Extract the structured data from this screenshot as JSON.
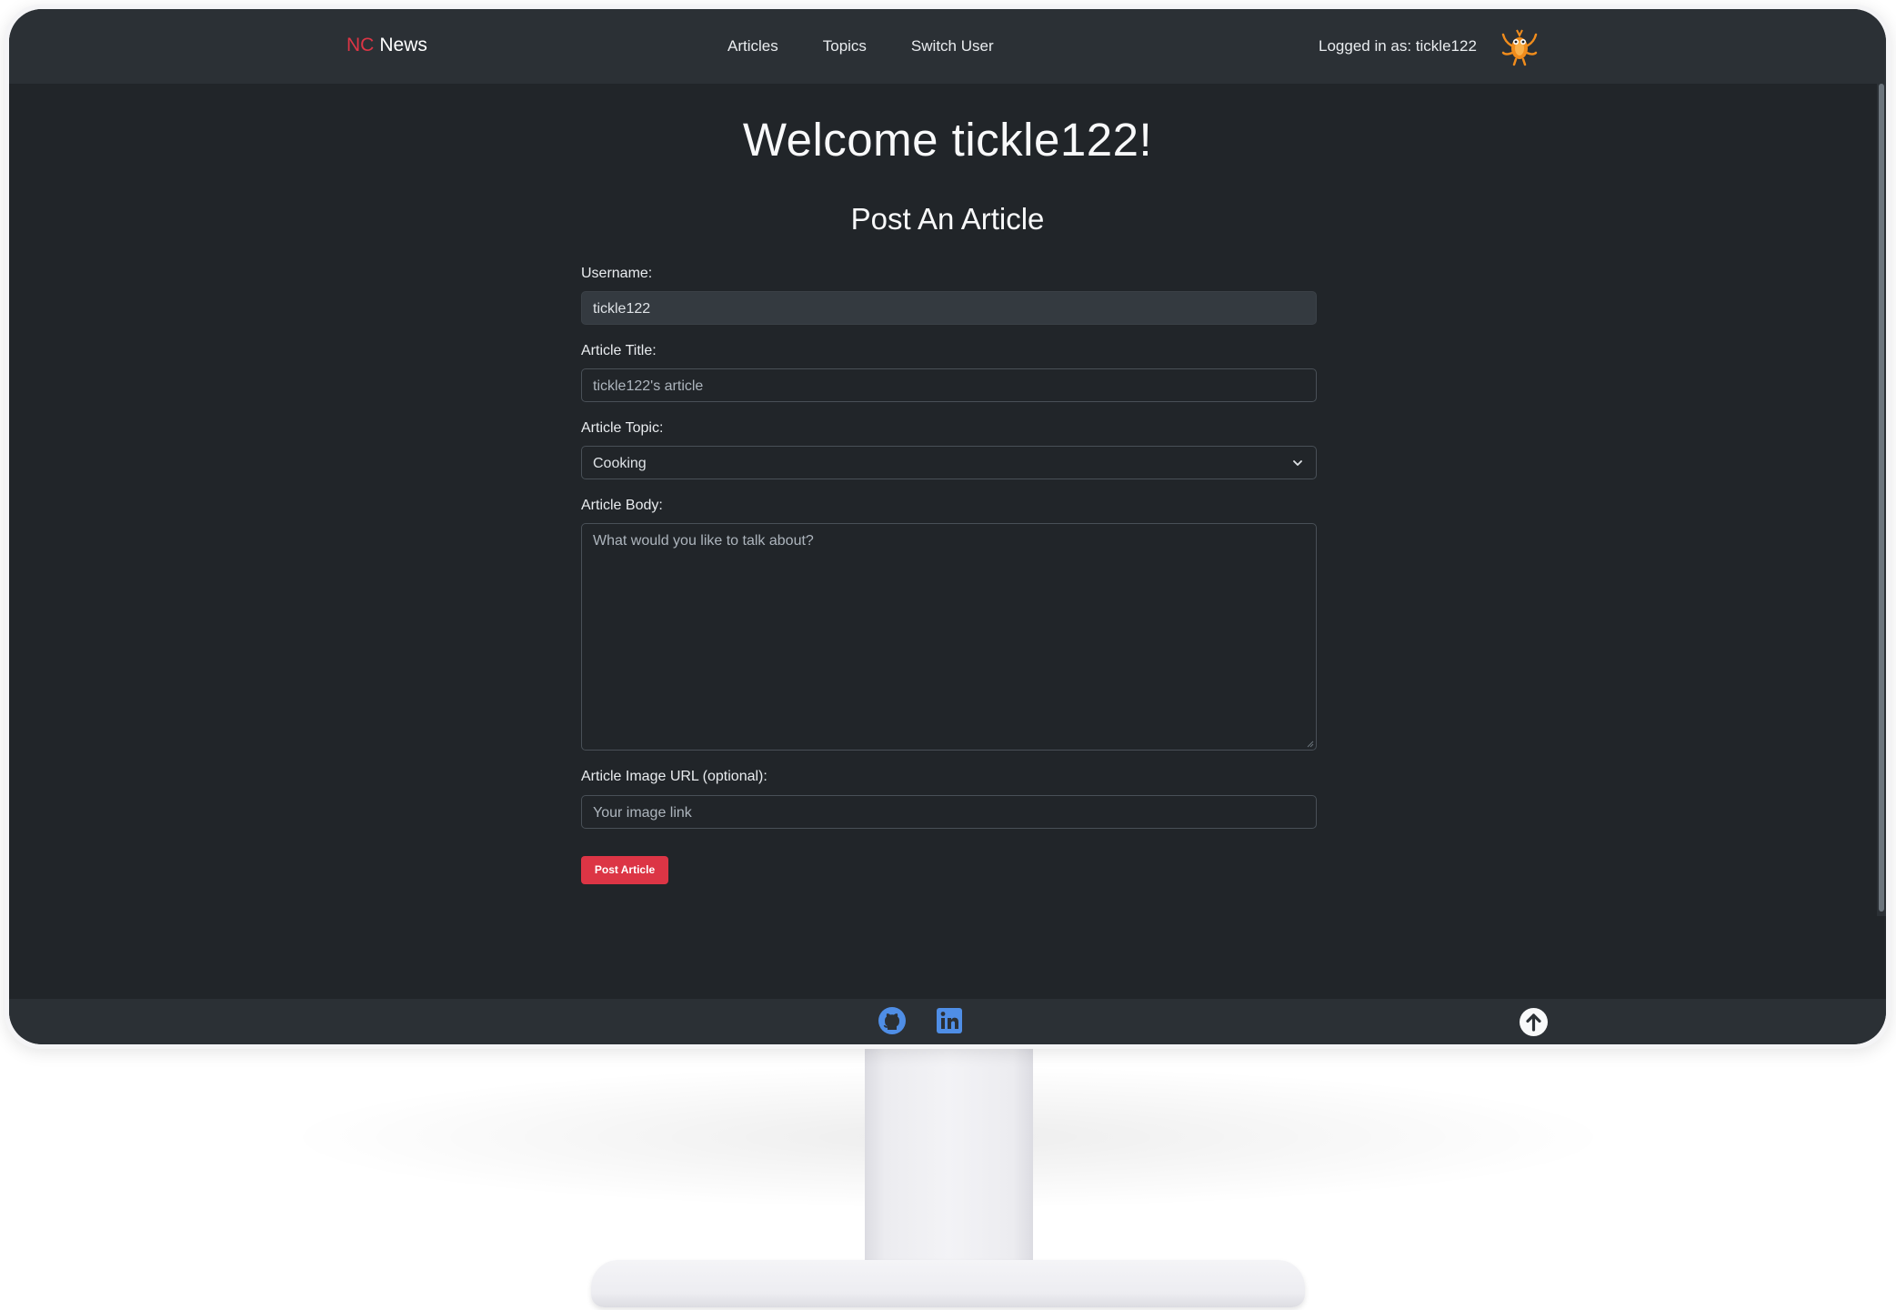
{
  "navbar": {
    "brand_prefix": "NC",
    "brand_name": "News",
    "links": [
      "Articles",
      "Topics",
      "Switch User"
    ],
    "logged_in_text": "Logged in as: tickle122",
    "avatar_icon": "cartoon-character-avatar"
  },
  "main": {
    "welcome": "Welcome tickle122!",
    "heading": "Post An Article"
  },
  "form": {
    "username_label": "Username:",
    "username_value": "tickle122",
    "title_label": "Article Title:",
    "title_placeholder": "tickle122's article",
    "topic_label": "Article Topic:",
    "topic_value": "Cooking",
    "body_label": "Article Body:",
    "body_placeholder": "What would you like to talk about?",
    "image_label": "Article Image URL (optional):",
    "image_placeholder": "Your image link",
    "submit_label": "Post Article"
  },
  "footer": {
    "icons": [
      "github-icon",
      "linkedin-icon",
      "scroll-to-top-icon"
    ]
  },
  "colors": {
    "background": "#212529",
    "navbar": "#2b3035",
    "accent": "#dc3545",
    "footer_icon": "#4f8ee6"
  }
}
